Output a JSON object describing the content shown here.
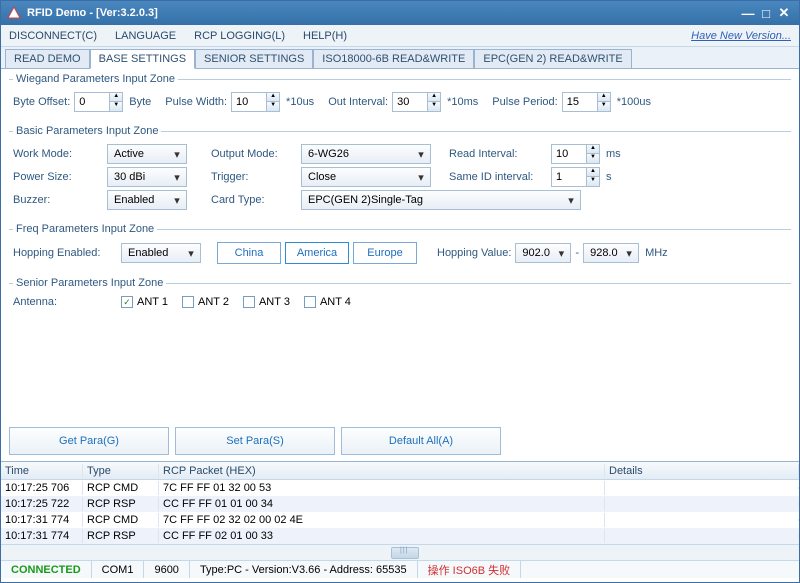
{
  "title": "RFID Demo - [Ver:3.2.0.3]",
  "menubar": {
    "disconnect": "DISCONNECT(C)",
    "language": "LANGUAGE",
    "rcplogging": "RCP LOGGING(L)",
    "help": "HELP(H)",
    "newversion": "Have New Version..."
  },
  "tabs": {
    "readdemo": "READ DEMO",
    "basesettings": "BASE SETTINGS",
    "seniorsettings": "SENIOR SETTINGS",
    "iso18000": "ISO18000-6B READ&WRITE",
    "epcgen2": "EPC(GEN 2) READ&WRITE"
  },
  "wiegand": {
    "legend": "Wiegand Parameters Input Zone",
    "byteoffset_lbl": "Byte Offset:",
    "byteoffset": "0",
    "byte_lbl": "Byte",
    "pulsewidth_lbl": "Pulse Width:",
    "pulsewidth": "10",
    "pulsewidth_unit": "*10us",
    "outinterval_lbl": "Out Interval:",
    "outinterval": "30",
    "outinterval_unit": "*10ms",
    "pulseperiod_lbl": "Pulse Period:",
    "pulseperiod": "15",
    "pulseperiod_unit": "*100us"
  },
  "basic": {
    "legend": "Basic Parameters Input Zone",
    "workmode_lbl": "Work Mode:",
    "workmode": "Active",
    "outputmode_lbl": "Output Mode:",
    "outputmode": "6-WG26",
    "readinterval_lbl": "Read Interval:",
    "readinterval": "10",
    "readinterval_unit": "ms",
    "powersize_lbl": "Power Size:",
    "powersize": "30 dBi",
    "trigger_lbl": "Trigger:",
    "trigger": "Close",
    "sameid_lbl": "Same ID interval:",
    "sameid": "1",
    "sameid_unit": "s",
    "buzzer_lbl": "Buzzer:",
    "buzzer": "Enabled",
    "cardtype_lbl": "Card Type:",
    "cardtype": "EPC(GEN 2)Single-Tag"
  },
  "freq": {
    "legend": "Freq Parameters Input Zone",
    "hopping_lbl": "Hopping Enabled:",
    "hopping": "Enabled",
    "region_china": "China",
    "region_america": "America",
    "region_europe": "Europe",
    "hopvalue_lbl": "Hopping Value:",
    "hopfrom": "902.0",
    "hopto": "928.0",
    "unit": "MHz"
  },
  "senior": {
    "legend": "Senior Parameters Input Zone",
    "antenna_lbl": "Antenna:",
    "ant1": "ANT 1",
    "ant2": "ANT 2",
    "ant3": "ANT 3",
    "ant4": "ANT 4"
  },
  "buttons": {
    "getpara": "Get Para(G)",
    "setpara": "Set Para(S)",
    "defaultall": "Default All(A)"
  },
  "log": {
    "hdr_time": "Time",
    "hdr_type": "Type",
    "hdr_hex": "RCP Packet (HEX)",
    "hdr_details": "Details",
    "rows": [
      {
        "time": "10:17:25 706",
        "type": "RCP CMD",
        "hex": "7C FF FF 01 32 00 53",
        "det": ""
      },
      {
        "time": "10:17:25 722",
        "type": "RCP RSP",
        "hex": "CC FF FF 01 01 00 34",
        "det": ""
      },
      {
        "time": "10:17:31 774",
        "type": "RCP CMD",
        "hex": "7C FF FF 02 32 02 00 02 4E",
        "det": ""
      },
      {
        "time": "10:17:31 774",
        "type": "RCP RSP",
        "hex": "CC FF FF 02 01 00 33",
        "det": ""
      }
    ]
  },
  "status": {
    "connected": "CONNECTED",
    "com": "COM1",
    "baud": "9600",
    "fw": "Type:PC - Version:V3.66 - Address: 65535",
    "err": "操作 ISO6B 失败"
  },
  "icons": {
    "dropdown": "▾",
    "up": "▲",
    "dn": "▼",
    "check": "✓"
  }
}
